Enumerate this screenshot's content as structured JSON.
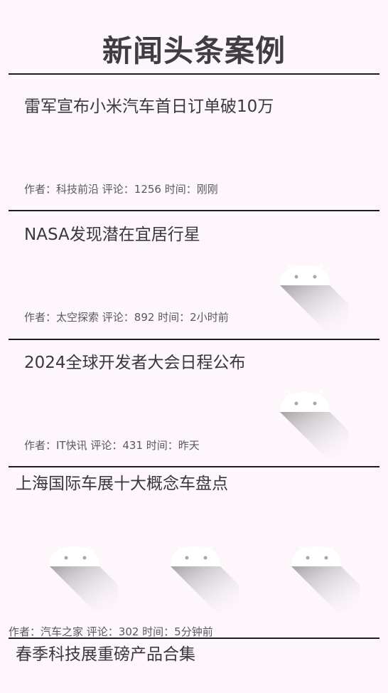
{
  "app": {
    "title": "新闻头条案例"
  },
  "news": [
    {
      "headline": "雷军宣布小米汽车首日订单破10万",
      "meta": "作者：科技前沿 评论：1256 时间：刚刚"
    },
    {
      "headline": "NASA发现潜在宜居行星",
      "meta": "作者：太空探索 评论：892 时间：2小时前"
    },
    {
      "headline": "2024全球开发者大会日程公布",
      "meta": "作者：IT快讯 评论：431 时间：昨天"
    },
    {
      "headline": "上海国际车展十大概念车盘点",
      "meta": "作者：汽车之家 评论：302 时间：5分钟前"
    },
    {
      "headline": "春季科技展重磅产品合集"
    }
  ],
  "icons": {
    "thumbnail": "android-placeholder-icon"
  },
  "colors": {
    "background": "#fdf7fb",
    "divider": "#1f1d21",
    "text": "#3d3a40"
  }
}
